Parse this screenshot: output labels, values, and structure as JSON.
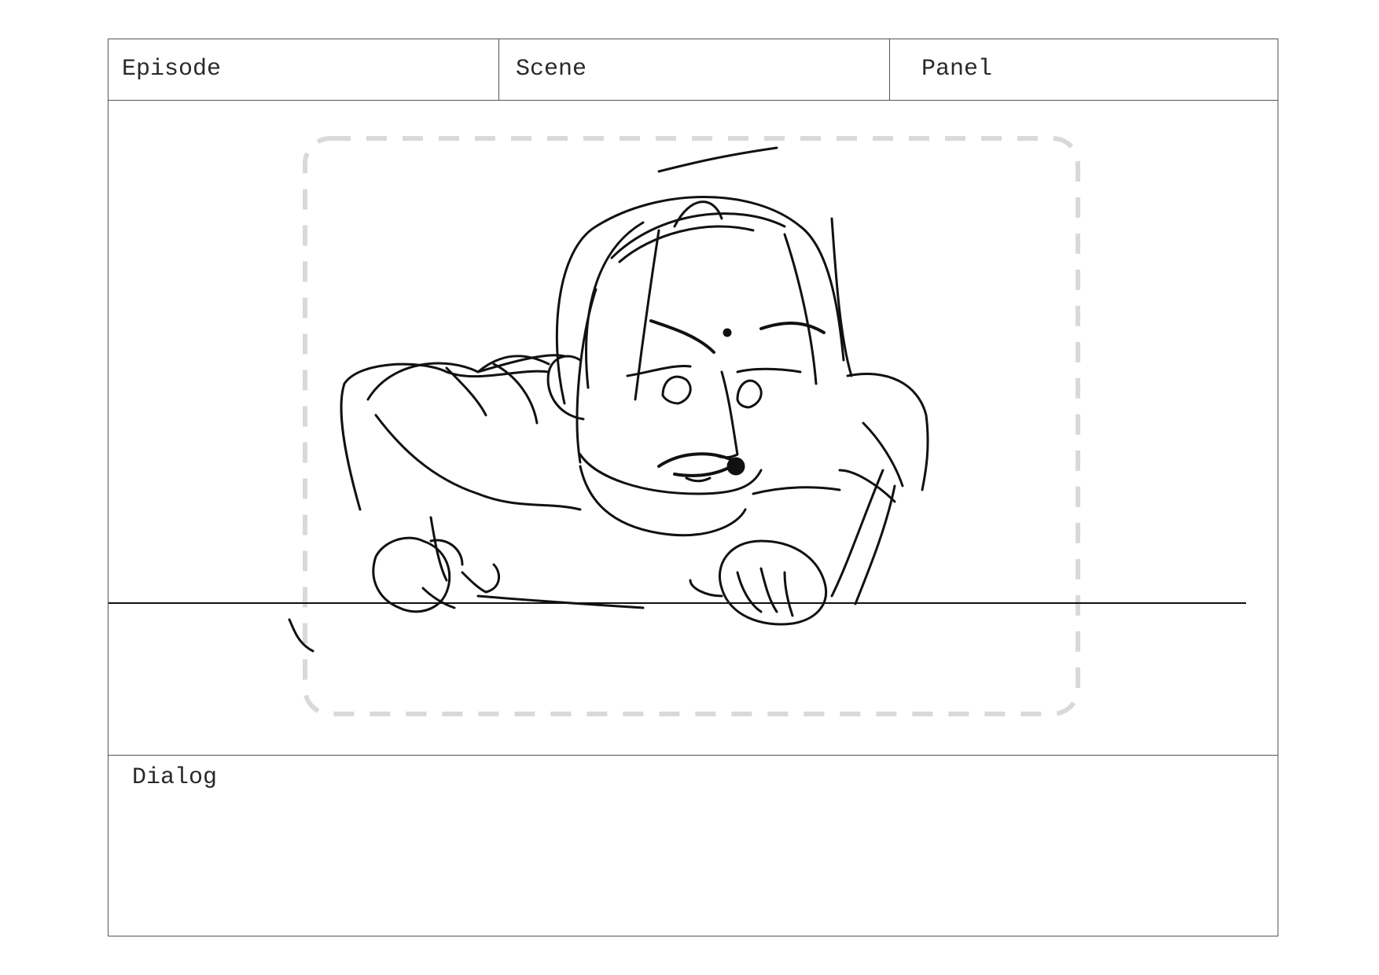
{
  "header": {
    "episode_label": "Episode",
    "scene_label": "Scene",
    "panel_label": "Panel"
  },
  "dialog": {
    "label": "Dialog"
  },
  "colors": {
    "border": "#555555",
    "sketch": "#111111",
    "safe_frame": "#d9d9d9"
  },
  "drawing": {
    "subject": "sketch-character-leaning-on-table"
  }
}
